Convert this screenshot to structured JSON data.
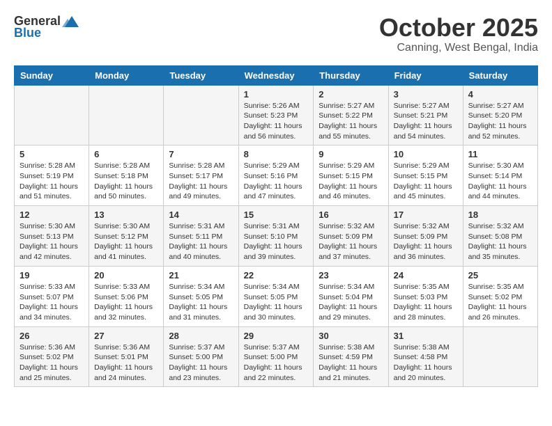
{
  "header": {
    "logo_general": "General",
    "logo_blue": "Blue",
    "month_title": "October 2025",
    "location": "Canning, West Bengal, India"
  },
  "days_of_week": [
    "Sunday",
    "Monday",
    "Tuesday",
    "Wednesday",
    "Thursday",
    "Friday",
    "Saturday"
  ],
  "weeks": [
    [
      {
        "day": "",
        "info": ""
      },
      {
        "day": "",
        "info": ""
      },
      {
        "day": "",
        "info": ""
      },
      {
        "day": "1",
        "info": "Sunrise: 5:26 AM\nSunset: 5:23 PM\nDaylight: 11 hours\nand 56 minutes."
      },
      {
        "day": "2",
        "info": "Sunrise: 5:27 AM\nSunset: 5:22 PM\nDaylight: 11 hours\nand 55 minutes."
      },
      {
        "day": "3",
        "info": "Sunrise: 5:27 AM\nSunset: 5:21 PM\nDaylight: 11 hours\nand 54 minutes."
      },
      {
        "day": "4",
        "info": "Sunrise: 5:27 AM\nSunset: 5:20 PM\nDaylight: 11 hours\nand 52 minutes."
      }
    ],
    [
      {
        "day": "5",
        "info": "Sunrise: 5:28 AM\nSunset: 5:19 PM\nDaylight: 11 hours\nand 51 minutes."
      },
      {
        "day": "6",
        "info": "Sunrise: 5:28 AM\nSunset: 5:18 PM\nDaylight: 11 hours\nand 50 minutes."
      },
      {
        "day": "7",
        "info": "Sunrise: 5:28 AM\nSunset: 5:17 PM\nDaylight: 11 hours\nand 49 minutes."
      },
      {
        "day": "8",
        "info": "Sunrise: 5:29 AM\nSunset: 5:16 PM\nDaylight: 11 hours\nand 47 minutes."
      },
      {
        "day": "9",
        "info": "Sunrise: 5:29 AM\nSunset: 5:15 PM\nDaylight: 11 hours\nand 46 minutes."
      },
      {
        "day": "10",
        "info": "Sunrise: 5:29 AM\nSunset: 5:15 PM\nDaylight: 11 hours\nand 45 minutes."
      },
      {
        "day": "11",
        "info": "Sunrise: 5:30 AM\nSunset: 5:14 PM\nDaylight: 11 hours\nand 44 minutes."
      }
    ],
    [
      {
        "day": "12",
        "info": "Sunrise: 5:30 AM\nSunset: 5:13 PM\nDaylight: 11 hours\nand 42 minutes."
      },
      {
        "day": "13",
        "info": "Sunrise: 5:30 AM\nSunset: 5:12 PM\nDaylight: 11 hours\nand 41 minutes."
      },
      {
        "day": "14",
        "info": "Sunrise: 5:31 AM\nSunset: 5:11 PM\nDaylight: 11 hours\nand 40 minutes."
      },
      {
        "day": "15",
        "info": "Sunrise: 5:31 AM\nSunset: 5:10 PM\nDaylight: 11 hours\nand 39 minutes."
      },
      {
        "day": "16",
        "info": "Sunrise: 5:32 AM\nSunset: 5:09 PM\nDaylight: 11 hours\nand 37 minutes."
      },
      {
        "day": "17",
        "info": "Sunrise: 5:32 AM\nSunset: 5:09 PM\nDaylight: 11 hours\nand 36 minutes."
      },
      {
        "day": "18",
        "info": "Sunrise: 5:32 AM\nSunset: 5:08 PM\nDaylight: 11 hours\nand 35 minutes."
      }
    ],
    [
      {
        "day": "19",
        "info": "Sunrise: 5:33 AM\nSunset: 5:07 PM\nDaylight: 11 hours\nand 34 minutes."
      },
      {
        "day": "20",
        "info": "Sunrise: 5:33 AM\nSunset: 5:06 PM\nDaylight: 11 hours\nand 32 minutes."
      },
      {
        "day": "21",
        "info": "Sunrise: 5:34 AM\nSunset: 5:05 PM\nDaylight: 11 hours\nand 31 minutes."
      },
      {
        "day": "22",
        "info": "Sunrise: 5:34 AM\nSunset: 5:05 PM\nDaylight: 11 hours\nand 30 minutes."
      },
      {
        "day": "23",
        "info": "Sunrise: 5:34 AM\nSunset: 5:04 PM\nDaylight: 11 hours\nand 29 minutes."
      },
      {
        "day": "24",
        "info": "Sunrise: 5:35 AM\nSunset: 5:03 PM\nDaylight: 11 hours\nand 28 minutes."
      },
      {
        "day": "25",
        "info": "Sunrise: 5:35 AM\nSunset: 5:02 PM\nDaylight: 11 hours\nand 26 minutes."
      }
    ],
    [
      {
        "day": "26",
        "info": "Sunrise: 5:36 AM\nSunset: 5:02 PM\nDaylight: 11 hours\nand 25 minutes."
      },
      {
        "day": "27",
        "info": "Sunrise: 5:36 AM\nSunset: 5:01 PM\nDaylight: 11 hours\nand 24 minutes."
      },
      {
        "day": "28",
        "info": "Sunrise: 5:37 AM\nSunset: 5:00 PM\nDaylight: 11 hours\nand 23 minutes."
      },
      {
        "day": "29",
        "info": "Sunrise: 5:37 AM\nSunset: 5:00 PM\nDaylight: 11 hours\nand 22 minutes."
      },
      {
        "day": "30",
        "info": "Sunrise: 5:38 AM\nSunset: 4:59 PM\nDaylight: 11 hours\nand 21 minutes."
      },
      {
        "day": "31",
        "info": "Sunrise: 5:38 AM\nSunset: 4:58 PM\nDaylight: 11 hours\nand 20 minutes."
      },
      {
        "day": "",
        "info": ""
      }
    ]
  ]
}
